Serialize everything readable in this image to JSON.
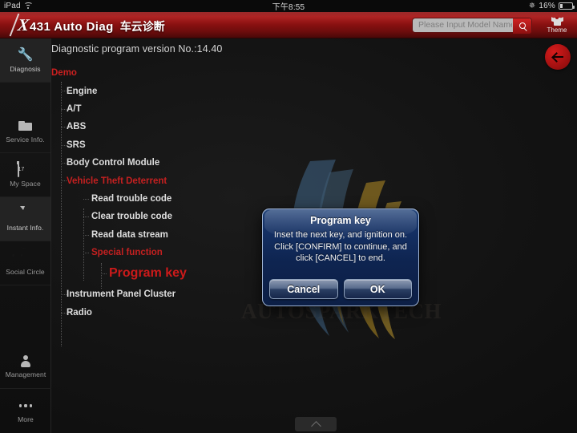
{
  "statusbar": {
    "device": "iPad",
    "wifi_icon": "wifi-icon",
    "time": "下午8:55",
    "bluetooth_icon": "bluetooth-icon",
    "battery_percent": "16%",
    "battery_icon": "battery-icon"
  },
  "header": {
    "brand_x": "X",
    "brand_num": "431 Auto Diag",
    "brand_cn": "车云诊断",
    "search": {
      "placeholder": "Please Input Model Name",
      "value": "",
      "button_icon": "search-icon"
    },
    "theme": {
      "label": "Theme",
      "icon": "tshirt-icon"
    }
  },
  "sidebar": {
    "items": [
      {
        "label": "Diagnosis",
        "icon": "wrench-icon",
        "active": true
      },
      {
        "label": "Service Info.",
        "icon": "folder-icon",
        "active": false
      },
      {
        "label": "My Space",
        "icon": "calendar-icon",
        "active": false
      },
      {
        "label": "Instant Info.",
        "icon": "chat-icon",
        "active": true
      },
      {
        "label": "Social Circle",
        "icon": "smiley-icon",
        "active": false
      }
    ],
    "bottom_items": [
      {
        "label": "Management",
        "icon": "user-icon"
      },
      {
        "label": "More",
        "icon": "ellipsis-icon"
      }
    ]
  },
  "main": {
    "version_text": "Diagnostic program version No.:14.40",
    "back_button": {
      "icon": "arrow-left-icon"
    },
    "watermark_text": "AUTOSPARKTECH",
    "tree": [
      {
        "label": "Demo",
        "level": 0,
        "style": "root"
      },
      {
        "label": "Engine",
        "level": 1,
        "style": "normal"
      },
      {
        "label": "A/T",
        "level": 1,
        "style": "normal"
      },
      {
        "label": "ABS",
        "level": 1,
        "style": "normal"
      },
      {
        "label": "SRS",
        "level": 1,
        "style": "normal"
      },
      {
        "label": "Body Control Module",
        "level": 1,
        "style": "normal"
      },
      {
        "label": "Vehicle Theft Deterrent",
        "level": 1,
        "style": "red"
      },
      {
        "label": "Read trouble code",
        "level": 2,
        "style": "normal"
      },
      {
        "label": "Clear trouble code",
        "level": 2,
        "style": "normal"
      },
      {
        "label": "Read data stream",
        "level": 2,
        "style": "normal"
      },
      {
        "label": "Special function",
        "level": 2,
        "style": "red"
      },
      {
        "label": "Program key",
        "level": 3,
        "style": "bigred"
      },
      {
        "label": "Instrument Panel Cluster",
        "level": 1,
        "style": "normal"
      },
      {
        "label": "Radio",
        "level": 1,
        "style": "normal"
      }
    ]
  },
  "dialog": {
    "title": "Program key",
    "message": "Inset the next key, and ignition on. Click [CONFIRM] to continue, and click [CANCEL] to end.",
    "cancel_label": "Cancel",
    "ok_label": "OK"
  },
  "home_indicator": {
    "icon": "chevron-up-icon"
  },
  "colors": {
    "header_red": "#a81414",
    "accent_red": "#c42020",
    "highlight_red": "#cc1a1a",
    "dialog_blue": "#16346a",
    "bg_dark": "#0e0e0e"
  }
}
